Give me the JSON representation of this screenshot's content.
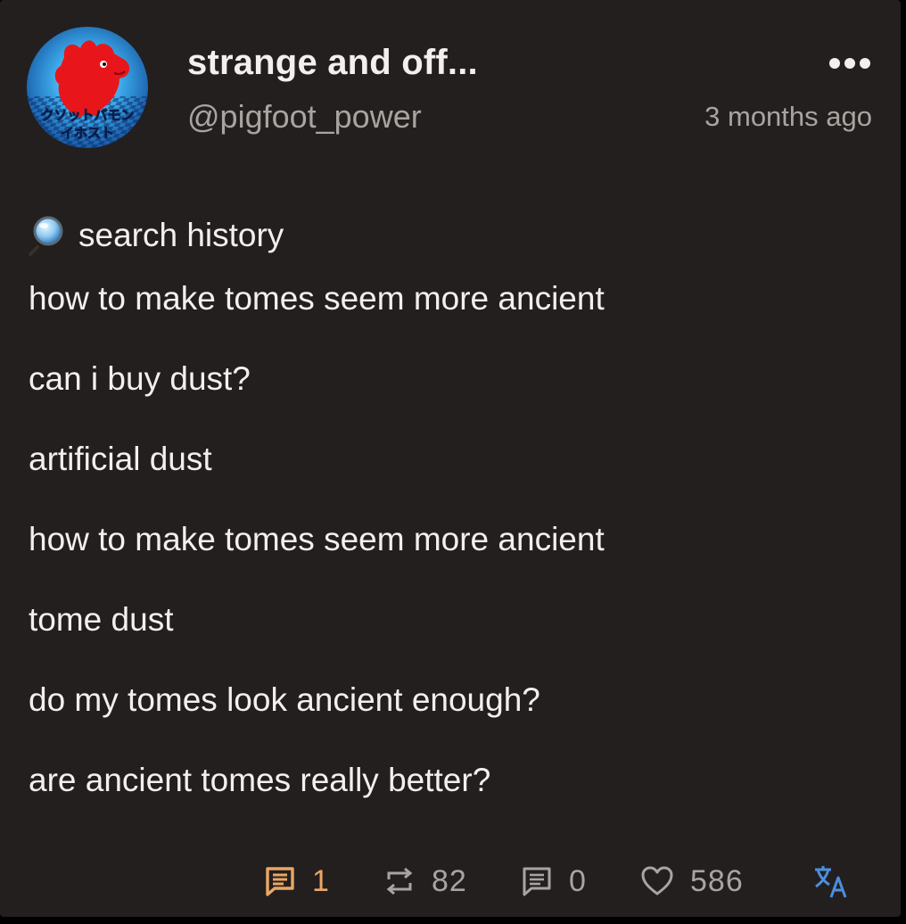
{
  "post": {
    "display_name": "strange and off...",
    "handle": "@pigfoot_power",
    "timestamp": "3 months ago",
    "avatar_text": "クソットバモン イホスト",
    "lines": [
      "search history",
      "how to make tomes seem more ancient",
      "can i buy dust?",
      "artificial dust",
      "how to make tomes seem more ancient",
      "tome dust",
      "do my tomes look ancient enough?",
      "are ancient tomes really better?"
    ]
  },
  "actions": {
    "replies": "1",
    "reblogs": "82",
    "quotes": "0",
    "likes": "586"
  },
  "icons": {
    "search": "magnifying-glass-icon",
    "more": "more-dots-icon",
    "reply": "reply-icon",
    "reblog": "reblog-icon",
    "quote": "comment-icon",
    "like": "heart-icon",
    "translate": "translate-icon"
  },
  "colors": {
    "background": "#231f1e",
    "text": "#f2f0ef",
    "muted": "#a8a4a1",
    "reply_accent": "#e9a765",
    "translate_accent": "#4b8fe0"
  }
}
